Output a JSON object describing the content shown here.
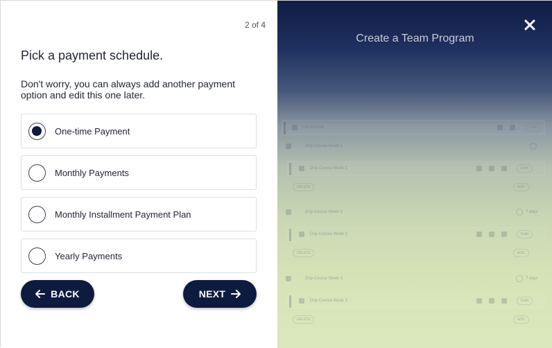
{
  "wizard": {
    "step_indicator": "2 of 4",
    "heading": "Pick a payment schedule.",
    "subtext": "Don't worry, you can always add another payment option and edit this one later.",
    "options": [
      {
        "label": "One-time Payment",
        "selected": true
      },
      {
        "label": "Monthly Payments",
        "selected": false
      },
      {
        "label": "Monthly Installment Payment Plan",
        "selected": false
      },
      {
        "label": "Yearly Payments",
        "selected": false
      }
    ],
    "back_label": "BACK",
    "next_label": "NEXT"
  },
  "preview": {
    "title": "Create a Team Program",
    "close_icon": "close-icon",
    "course": {
      "name": "Drip Course",
      "status": "Draft"
    },
    "weeks": [
      {
        "name": "Drip Course Week 1",
        "item": "Drip Course Week 1",
        "status": "Draft",
        "days": "",
        "delete": "DELETE",
        "add": "ADD"
      },
      {
        "name": "Drip Course Week 2",
        "item": "Drip Course Week 2",
        "status": "Draft",
        "days": "7 days",
        "delete": "DELETE",
        "add": "ADD"
      },
      {
        "name": "Drip Course Week 3",
        "item": "Drip Course Week 3",
        "status": "Draft",
        "days": "7 days",
        "delete": "DELETE",
        "add": "ADD"
      }
    ]
  },
  "colors": {
    "primary": "#0d1b3e",
    "panel_top": "#0f1c45",
    "panel_bottom": "#dbe7bc"
  }
}
